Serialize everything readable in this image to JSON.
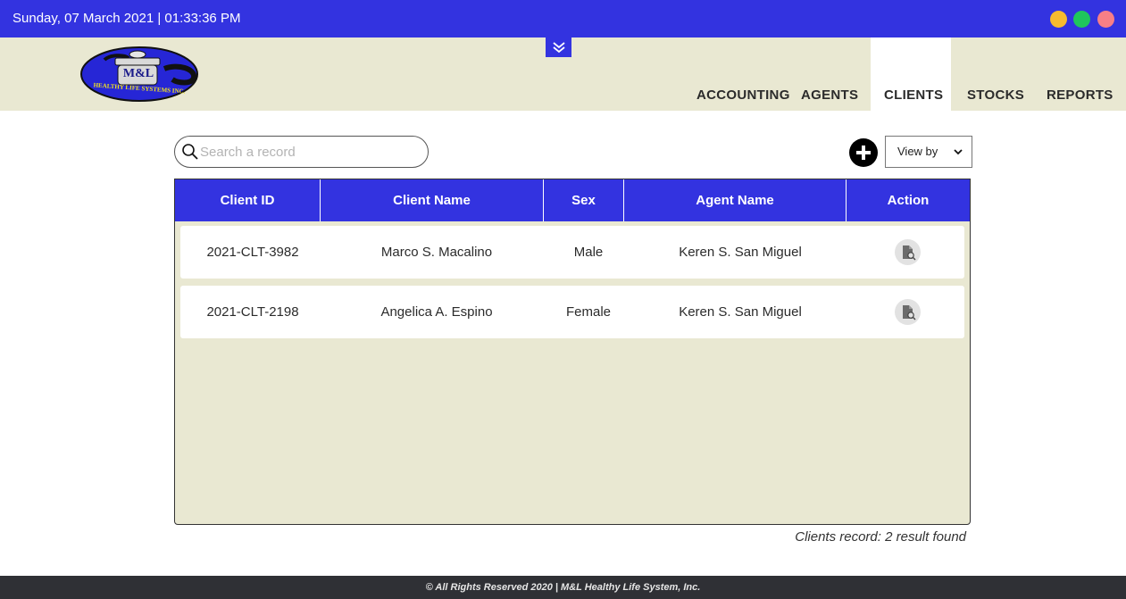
{
  "topbar": {
    "datetime": "Sunday, 07 March 2021 | 01:33:36 PM",
    "colors": {
      "bar": "#3333e0",
      "minimize": "#f7bb2e",
      "maximize": "#1fc65c",
      "close": "#f77f86"
    }
  },
  "logo": {
    "main": "M&L",
    "tagline": "HEALTHY LIFE SYSTEMS INC."
  },
  "nav": {
    "items": [
      {
        "label": "ACCOUNTING",
        "active": false
      },
      {
        "label": "AGENTS",
        "active": false
      },
      {
        "label": "CLIENTS",
        "active": true
      },
      {
        "label": "STOCKS",
        "active": false
      },
      {
        "label": "REPORTS",
        "active": false
      }
    ]
  },
  "toolbar": {
    "search_placeholder": "Search a record",
    "search_value": "",
    "add_icon": "plus-circle-icon",
    "view_by_label": "View by"
  },
  "table": {
    "columns": [
      "Client ID",
      "Client Name",
      "Sex",
      "Agent Name",
      "Action"
    ],
    "rows": [
      {
        "client_id": "2021-CLT-3982",
        "client_name": "Marco S. Macalino",
        "sex": "Male",
        "agent_name": "Keren S. San Miguel",
        "action_icon": "view-document-icon"
      },
      {
        "client_id": "2021-CLT-2198",
        "client_name": "Angelica A. Espino",
        "sex": "Female",
        "agent_name": "Keren S. San Miguel",
        "action_icon": "view-document-icon"
      }
    ]
  },
  "result_text": "Clients record: 2 result found",
  "footer": {
    "text": "© All Rights Reserved 2020 | M&L Healthy Life System, Inc."
  },
  "colors": {
    "accent": "#3333e0",
    "panel": "#e9e8d2",
    "footer": "#2f3035"
  }
}
